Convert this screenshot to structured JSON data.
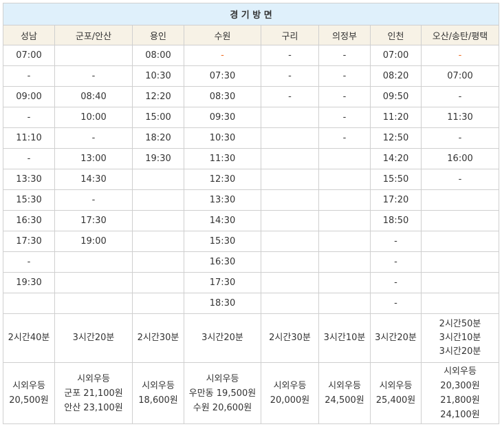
{
  "title": "경 기 방 면",
  "columns": [
    "성남",
    "군포/안산",
    "용인",
    "수원",
    "구리",
    "의정부",
    "인천",
    "오산/송탄/평택"
  ],
  "rows": [
    [
      "07:00",
      "",
      "08:00",
      "-",
      "-",
      "-",
      "07:00",
      "-"
    ],
    [
      "-",
      "-",
      "10:30",
      "07:30",
      "-",
      "-",
      "08:20",
      "07:00"
    ],
    [
      "09:00",
      "08:40",
      "12:20",
      "08:30",
      "-",
      "-",
      "09:50",
      "-"
    ],
    [
      "-",
      "10:00",
      "15:00",
      "09:30",
      "",
      "-",
      "11:20",
      "11:30"
    ],
    [
      "11:10",
      "-",
      "18:20",
      "10:30",
      "",
      "-",
      "12:50",
      "-"
    ],
    [
      "-",
      "13:00",
      "19:30",
      "11:30",
      "",
      "",
      "14:20",
      "16:00"
    ],
    [
      "13:30",
      "14:30",
      "",
      "12:30",
      "",
      "",
      "15:50",
      "-"
    ],
    [
      "15:30",
      "-",
      "",
      "13:30",
      "",
      "",
      "17:20",
      ""
    ],
    [
      "16:30",
      "17:30",
      "",
      "14:30",
      "",
      "",
      "18:50",
      ""
    ],
    [
      "17:30",
      "19:00",
      "",
      "15:30",
      "",
      "",
      "-",
      ""
    ],
    [
      "-",
      "",
      "",
      "16:30",
      "",
      "",
      "-",
      ""
    ],
    [
      "19:30",
      "",
      "",
      "17:30",
      "",
      "",
      "-",
      ""
    ],
    [
      "",
      "",
      "",
      "18:30",
      "",
      "",
      "-",
      ""
    ]
  ],
  "orange_cells": [
    [
      0,
      3
    ],
    [
      0,
      7
    ]
  ],
  "accent_color": "#f06a1e",
  "header_bg": "#f7f2e6",
  "title_bg": "#dff0fb",
  "durations": [
    [
      "2시간40분"
    ],
    [
      "3시간20분"
    ],
    [
      "2시간30분"
    ],
    [
      "3시간20분"
    ],
    [
      "2시간30분"
    ],
    [
      "3시간10분"
    ],
    [
      "3시간20분"
    ],
    [
      "2시간50분",
      "3시간10분",
      "3시간20분"
    ]
  ],
  "fares": [
    [
      "시외우등",
      "20,500원"
    ],
    [
      "시외우등",
      "군포 21,100원",
      "안산 23,100원"
    ],
    [
      "시외우등",
      "18,600원"
    ],
    [
      "시외우등",
      "우만동 19,500원",
      "수원 20,600원"
    ],
    [
      "시외우등",
      "20,000원"
    ],
    [
      "시외우등",
      "24,500원"
    ],
    [
      "시외우등",
      "25,400원"
    ],
    [
      "시외우등",
      "20,300원",
      "21,800원",
      "24,100원"
    ]
  ]
}
